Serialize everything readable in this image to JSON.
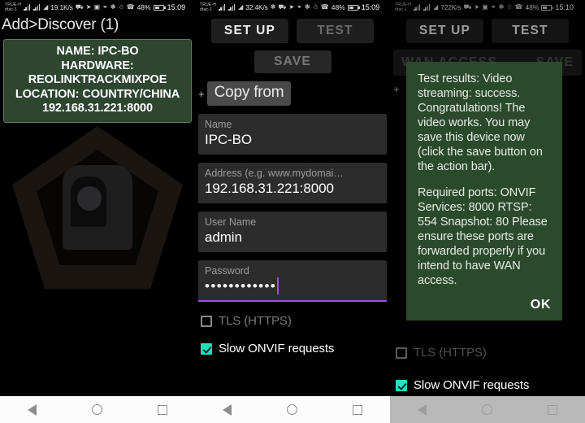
{
  "statusbars": [
    {
      "carrier_line1": "TRUE-H",
      "carrier_line2": "dtac-1",
      "speed": "19.1K/s",
      "battery_pct": "48%",
      "clock": "15:09",
      "icons": [
        "vpn-icon",
        "location-icon",
        "screenshot-icon",
        "key-icon",
        "do-not-disturb-icon",
        "bluetooth-icon",
        "call-icon"
      ]
    },
    {
      "carrier_line1": "TRUE-H",
      "carrier_line2": "dtac-1",
      "speed": "32.4K/s",
      "battery_pct": "48%",
      "clock": "15:09",
      "icons": [
        "sync-icon",
        "vpn-icon",
        "location-icon",
        "key-icon",
        "do-not-disturb-icon",
        "bluetooth-icon",
        "call-icon"
      ]
    },
    {
      "carrier_line1": "TRUE-H",
      "carrier_line2": "dtac-1",
      "speed": "722K/s",
      "battery_pct": "48%",
      "clock": "15:10",
      "icons": [
        "vpn-icon",
        "location-icon",
        "screenshot-icon",
        "key-icon",
        "do-not-disturb-icon",
        "bluetooth-icon",
        "call-icon"
      ]
    }
  ],
  "panel1": {
    "title": "Add>Discover (1)",
    "device_card": {
      "line1": "NAME: IPC-BO",
      "line2": "HARDWARE:",
      "line3": "REOLINKTRACKMIXPOE",
      "line4": "LOCATION: COUNTRY/CHINA",
      "line5": "192.168.31.221:8000"
    },
    "watermark": "camera-pentagon-watermark"
  },
  "panel2": {
    "actionbar": {
      "setup_label": "SET UP",
      "test_label": "TEST",
      "save_label": "SAVE"
    },
    "copy_from_label": "Copy from",
    "plus_label": "+",
    "fields": [
      {
        "label": "Name",
        "value": "IPC-BO"
      },
      {
        "label": "Address (e.g. www.mydomai…",
        "value": "192.168.31.221:8000"
      },
      {
        "label": "User Name",
        "value": "admin"
      },
      {
        "label": "Password",
        "value": "••••••••••••"
      }
    ],
    "checkboxes": [
      {
        "label": "TLS (HTTPS)",
        "checked": false,
        "enabled": false
      },
      {
        "label": "Slow ONVIF requests",
        "checked": true,
        "enabled": true
      }
    ]
  },
  "panel3": {
    "actionbar": {
      "setup_label": "SET UP",
      "test_label": "TEST"
    },
    "wan_row": {
      "left_label": "WAN ACCESS",
      "right_label": "SAVE"
    },
    "plus_label": "+",
    "dialog": {
      "para1": "Test results: Video streaming: success. Congratulations! The video works. You may save this device now (click the save button on the action bar).",
      "para2": "Required ports: ONVIF Services: 8000 RTSP: 554 Snapshot: 80 Please ensure these ports are forwarded properly if you intend to have WAN access.",
      "ok_label": "OK"
    },
    "checkboxes": [
      {
        "label": "TLS (HTTPS)",
        "checked": false,
        "enabled": false
      },
      {
        "label": "Slow ONVIF requests",
        "checked": true,
        "enabled": true
      }
    ]
  },
  "navbar": {
    "back": "back-triangle-icon",
    "home": "home-circle-icon",
    "recent": "recent-square-icon"
  },
  "colors": {
    "accent_purple": "#9b4dea",
    "checkbox_teal": "#1ee3bd",
    "dialog_green": "#2b4a2c",
    "card_green": "#2e4630"
  }
}
